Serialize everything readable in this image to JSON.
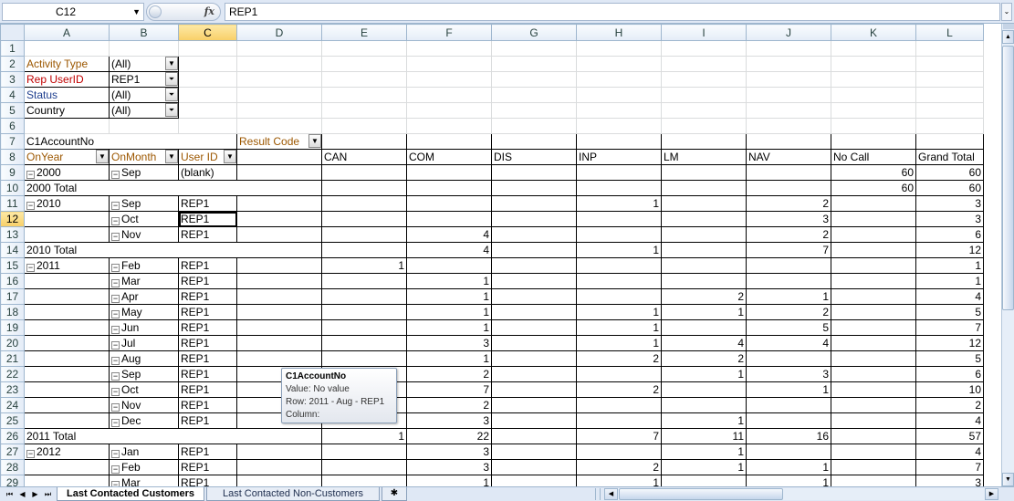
{
  "formula_bar": {
    "name_box": "C12",
    "fx_label": "fx",
    "formula": "REP1",
    "dropdown_glyph": "▼",
    "expand_glyph": "⌄"
  },
  "columns": [
    "A",
    "B",
    "C",
    "D",
    "E",
    "F",
    "G",
    "H",
    "I",
    "J",
    "K",
    "L"
  ],
  "selected": {
    "column": "C",
    "row": "12",
    "cell": "C12"
  },
  "icons": {
    "dropdown": "▼",
    "filter": "⏷",
    "collapse": "−"
  },
  "page_fields": [
    {
      "label": "Activity Type",
      "value": "(All)",
      "filtered": false
    },
    {
      "label": "Rep UserID",
      "value": "REP1",
      "filtered": true
    },
    {
      "label": "Status",
      "value": "(All)",
      "filtered": true
    },
    {
      "label": "Country",
      "value": "(All)",
      "filtered": true
    }
  ],
  "pivot": {
    "data_field": "C1AccountNo",
    "column_field": "Result Code",
    "row_fields": [
      "OnYear",
      "OnMonth",
      "User ID"
    ],
    "result_codes": [
      "CAN",
      "COM",
      "DIS",
      "INP",
      "LM",
      "NAV",
      "No Call",
      "Grand Total"
    ]
  },
  "rows": [
    {
      "n": "9",
      "year": "2000",
      "month": "Sep",
      "user": "(blank)",
      "vals": [
        "",
        "",
        "",
        "",
        "",
        "",
        "60",
        "60"
      ]
    },
    {
      "n": "10",
      "total": "2000 Total",
      "vals": [
        "",
        "",
        "",
        "",
        "",
        "",
        "60",
        "60"
      ]
    },
    {
      "n": "11",
      "year": "2010",
      "month": "Sep",
      "user": "REP1",
      "vals": [
        "",
        "",
        "",
        "1",
        "",
        "2",
        "",
        "3"
      ]
    },
    {
      "n": "12",
      "month": "Oct",
      "user": "REP1",
      "vals": [
        "",
        "",
        "",
        "",
        "",
        "3",
        "",
        "3"
      ]
    },
    {
      "n": "13",
      "month": "Nov",
      "user": "REP1",
      "vals": [
        "",
        "4",
        "",
        "",
        "",
        "2",
        "",
        "6"
      ]
    },
    {
      "n": "14",
      "total": "2010 Total",
      "vals": [
        "",
        "4",
        "",
        "1",
        "",
        "7",
        "",
        "12"
      ]
    },
    {
      "n": "15",
      "year": "2011",
      "month": "Feb",
      "user": "REP1",
      "vals": [
        "1",
        "",
        "",
        "",
        "",
        "",
        "",
        "1"
      ]
    },
    {
      "n": "16",
      "month": "Mar",
      "user": "REP1",
      "vals": [
        "",
        "1",
        "",
        "",
        "",
        "",
        "",
        "1"
      ]
    },
    {
      "n": "17",
      "month": "Apr",
      "user": "REP1",
      "vals": [
        "",
        "1",
        "",
        "",
        "2",
        "1",
        "",
        "4"
      ]
    },
    {
      "n": "18",
      "month": "May",
      "user": "REP1",
      "vals": [
        "",
        "1",
        "",
        "1",
        "1",
        "2",
        "",
        "5"
      ]
    },
    {
      "n": "19",
      "month": "Jun",
      "user": "REP1",
      "vals": [
        "",
        "1",
        "",
        "1",
        "",
        "5",
        "",
        "7"
      ]
    },
    {
      "n": "20",
      "month": "Jul",
      "user": "REP1",
      "vals": [
        "",
        "3",
        "",
        "1",
        "4",
        "4",
        "",
        "12"
      ]
    },
    {
      "n": "21",
      "month": "Aug",
      "user": "REP1",
      "vals": [
        "",
        "1",
        "",
        "2",
        "2",
        "",
        "",
        "5"
      ]
    },
    {
      "n": "22",
      "month": "Sep",
      "user": "REP1",
      "vals": [
        "",
        "2",
        "",
        "",
        "1",
        "3",
        "",
        "6"
      ]
    },
    {
      "n": "23",
      "month": "Oct",
      "user": "REP1",
      "vals": [
        "",
        "7",
        "",
        "2",
        "",
        "1",
        "",
        "10"
      ]
    },
    {
      "n": "24",
      "month": "Nov",
      "user": "REP1",
      "vals": [
        "",
        "2",
        "",
        "",
        "",
        "",
        "",
        "2"
      ]
    },
    {
      "n": "25",
      "month": "Dec",
      "user": "REP1",
      "vals": [
        "",
        "3",
        "",
        "",
        "1",
        "",
        "",
        "4"
      ]
    },
    {
      "n": "26",
      "total": "2011 Total",
      "vals": [
        "1",
        "22",
        "",
        "7",
        "11",
        "16",
        "",
        "57"
      ]
    },
    {
      "n": "27",
      "year": "2012",
      "month": "Jan",
      "user": "REP1",
      "vals": [
        "",
        "3",
        "",
        "",
        "1",
        "",
        "",
        "4"
      ]
    },
    {
      "n": "28",
      "month": "Feb",
      "user": "REP1",
      "vals": [
        "",
        "3",
        "",
        "2",
        "1",
        "1",
        "",
        "7"
      ]
    },
    {
      "n": "29",
      "month": "Mar",
      "user": "REP1",
      "vals": [
        "",
        "1",
        "",
        "1",
        "",
        "1",
        "",
        "3"
      ]
    }
  ],
  "tooltip": {
    "title": "C1AccountNo",
    "value": "Value: No value",
    "row": "Row: 2011 - Aug - REP1",
    "column": "Column:"
  },
  "sheet_nav": {
    "first": "⏮",
    "prev": "◀",
    "next": "▶",
    "last": "⏭"
  },
  "tabs": [
    "Last Contacted Customers",
    "Last Contacted Non-Customers"
  ],
  "insert_tab_glyph": "✱",
  "scroll_glyphs": {
    "up": "▲",
    "down": "▼",
    "left": "◀",
    "right": "▶"
  }
}
